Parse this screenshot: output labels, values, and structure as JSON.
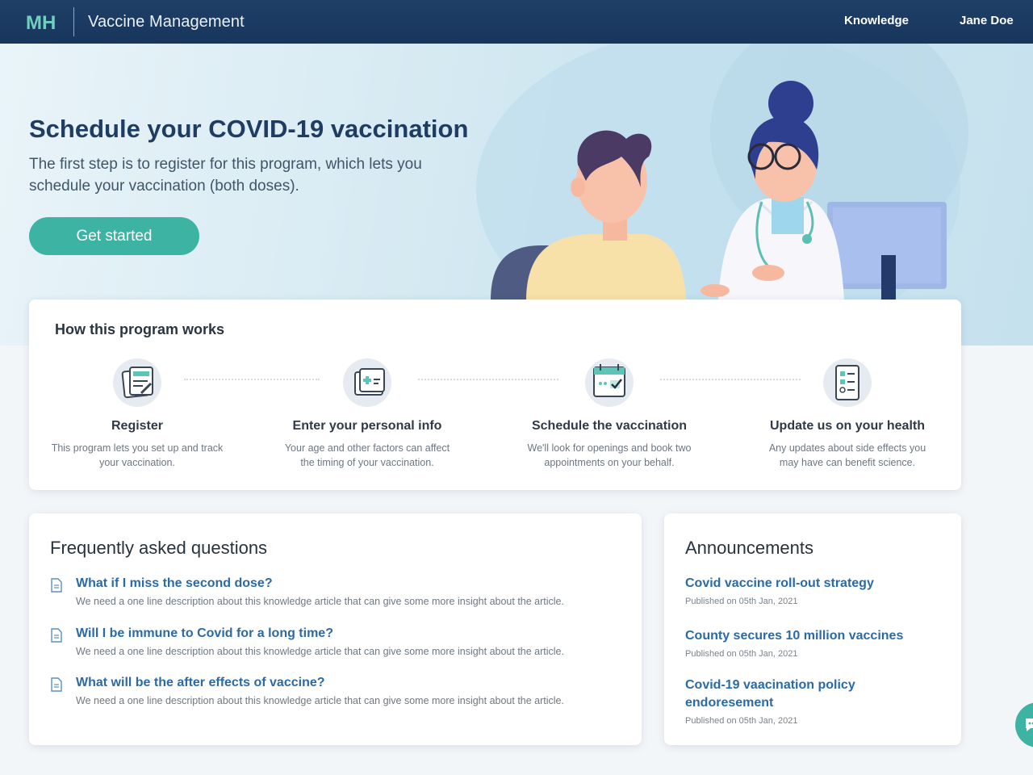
{
  "header": {
    "logo_text": "MH",
    "app_title": "Vaccine Management",
    "nav": {
      "knowledge": "Knowledge",
      "user": "Jane Doe"
    }
  },
  "hero": {
    "title": "Schedule your COVID-19 vaccination",
    "subtitle": "The first step is to register for this program, which lets you schedule your vaccination (both doses).",
    "cta_label": "Get started"
  },
  "how_it_works": {
    "title": "How this program works",
    "steps": [
      {
        "icon": "register-form-icon",
        "title": "Register",
        "desc": "This program lets you set up and track your vaccination."
      },
      {
        "icon": "medical-folder-icon",
        "title": "Enter your personal info",
        "desc": "Your age and other factors  can affect the timing of your vaccination."
      },
      {
        "icon": "calendar-check-icon",
        "title": "Schedule the vaccination",
        "desc": "We'll look for openings and book two appointments on your behalf."
      },
      {
        "icon": "health-checklist-icon",
        "title": "Update us on your health",
        "desc": "Any updates about side effects you may have can benefit science."
      }
    ]
  },
  "faq": {
    "title": "Frequently asked questions",
    "items": [
      {
        "q": "What if I miss the second dose?",
        "d": "We need a one line description about this knowledge article that can give some more insight about the article."
      },
      {
        "q": "Will I be immune to Covid for a long time?",
        "d": "We need a one line description about this knowledge article that can give some more insight about the article."
      },
      {
        "q": "What will  be the after effects of vaccine?",
        "d": "We need a one line description about this knowledge article that can give some more insight about the article."
      }
    ]
  },
  "announcements": {
    "title": "Announcements",
    "items": [
      {
        "t": "Covid vaccine roll-out strategy",
        "d": "Published on 05th Jan, 2021"
      },
      {
        "t": "County secures 10 million vaccines",
        "d": "Published on 05th Jan, 2021"
      },
      {
        "t": "Covid-19 vaacination  policy endoresement",
        "d": "Published on 05th Jan, 2021"
      }
    ]
  },
  "colors": {
    "header": "#1b3a61",
    "accent": "#3db4a3",
    "link": "#2b6aa5"
  }
}
